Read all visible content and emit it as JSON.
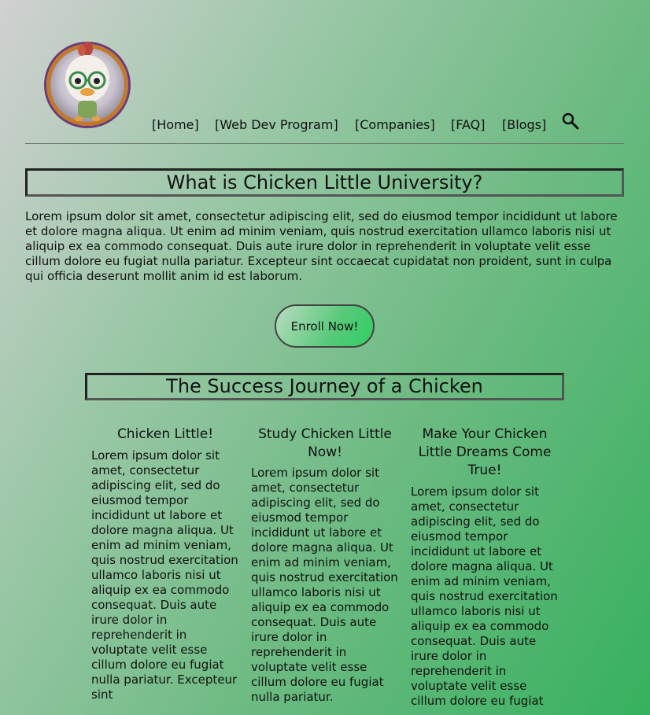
{
  "header": {
    "logo_alt": "Chicken Little",
    "nav": [
      "[Home]",
      "[Web Dev Program]",
      "[Companies]",
      "[FAQ]",
      "[Blogs]"
    ]
  },
  "intro": {
    "title": "What is Chicken Little University?",
    "body": "Lorem ipsum dolor sit amet, consectetur adipiscing elit, sed do eiusmod tempor incididunt ut labore et dolore magna aliqua. Ut enim ad minim veniam, quis nostrud exercitation ullamco laboris nisi ut aliquip ex ea commodo consequat. Duis aute irure dolor in reprehenderit in voluptate velit esse cillum dolore eu fugiat nulla pariatur. Excepteur sint occaecat cupidatat non proident, sunt in culpa qui officia deserunt mollit anim id est laborum.",
    "cta": "Enroll Now!"
  },
  "journey": {
    "title": "The Success Journey of a Chicken",
    "columns": [
      {
        "heading": "Chicken Little!",
        "body": "Lorem ipsum dolor sit amet, consectetur adipiscing elit, sed do eiusmod tempor incididunt ut labore et dolore magna aliqua. Ut enim ad minim veniam, quis nostrud exercitation ullamco laboris nisi ut aliquip ex ea commodo consequat. Duis aute irure dolor in reprehenderit in voluptate velit esse cillum dolore eu fugiat nulla pariatur. Excepteur sint"
      },
      {
        "heading": "Study Chicken Little Now!",
        "body": "Lorem ipsum dolor sit amet, consectetur adipiscing elit, sed do eiusmod tempor incididunt ut labore et dolore magna aliqua. Ut enim ad minim veniam, quis nostrud exercitation ullamco laboris nisi ut aliquip ex ea commodo consequat. Duis aute irure dolor in reprehenderit in voluptate velit esse cillum dolore eu fugiat nulla pariatur."
      },
      {
        "heading": "Make Your Chicken Little Dreams Come True!",
        "body": "Lorem ipsum dolor sit amet, consectetur adipiscing elit, sed do eiusmod tempor incididunt ut labore et dolore magna aliqua. Ut enim ad minim veniam, quis nostrud exercitation ullamco laboris nisi ut aliquip ex ea commodo consequat. Duis aute irure dolor in reprehenderit in voluptate velit esse cillum dolore eu fugiat"
      }
    ]
  },
  "icons": {
    "logo": "chicken-little-avatar",
    "search": "magnifier-icon"
  },
  "colors": {
    "background_start": "#d1d1d1",
    "background_end": "#36b15e",
    "button_start": "#b9dcc0",
    "button_end": "#2fcf62"
  }
}
